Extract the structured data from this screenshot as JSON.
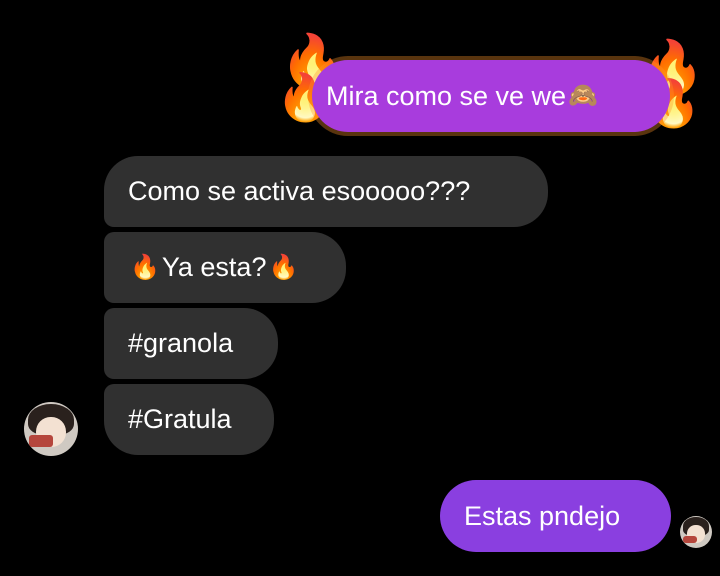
{
  "thread": {
    "outgoing_top": {
      "text": "Mira como se ve we",
      "emoji": "🙈",
      "effect_icon": "fire"
    },
    "incoming": [
      {
        "text": "Como se activa esooooo???"
      },
      {
        "lead_emoji": "🔥",
        "text": "Ya esta?",
        "trail_emoji": "🔥"
      },
      {
        "text": "#granola"
      },
      {
        "text": "#Gratula"
      }
    ],
    "outgoing_bottom": {
      "text": "Estas pndejo"
    }
  },
  "colors": {
    "background": "#000000",
    "incoming_bubble": "#303030",
    "outgoing_fire_bubble": "#a83cdd",
    "outgoing_bubble": "#8a3fe0"
  }
}
